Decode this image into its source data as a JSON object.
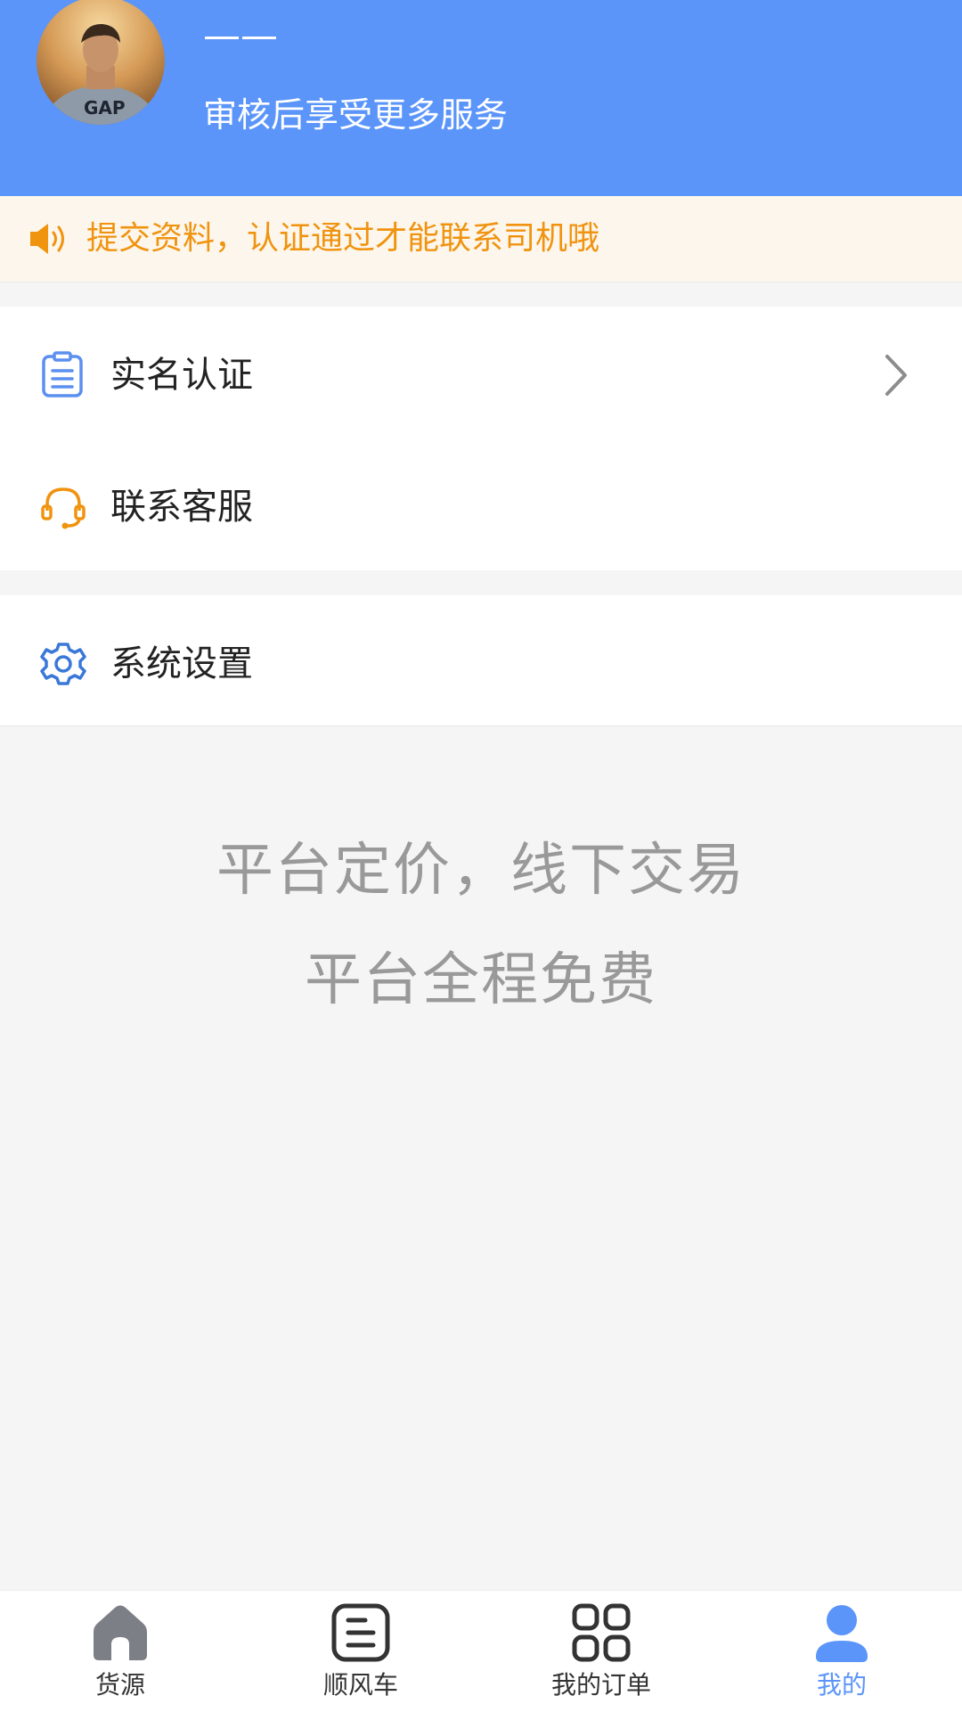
{
  "header": {
    "user_name": "——",
    "subtitle": "审核后享受更多服务",
    "avatar": "avatar-photo",
    "background_color": "#5b95fa"
  },
  "notice": {
    "icon": "speaker-icon",
    "text": "提交资料，认证通过才能联系司机哦",
    "color": "#f0930f"
  },
  "menu": {
    "group1": [
      {
        "label": "实名认证",
        "icon": "clipboard-icon",
        "chevron": true
      },
      {
        "label": "联系客服",
        "icon": "headset-icon",
        "chevron": false
      }
    ],
    "group2": [
      {
        "label": "系统设置",
        "icon": "gear-icon",
        "chevron": false
      }
    ]
  },
  "slogan": {
    "line1": "平台定价，线下交易",
    "line2": "平台全程免费"
  },
  "tabbar": {
    "active_color": "#5b95fa",
    "items": [
      {
        "label": "货源",
        "icon": "home-icon",
        "active": false
      },
      {
        "label": "顺风车",
        "icon": "list-icon",
        "active": false
      },
      {
        "label": "我的订单",
        "icon": "grid-icon",
        "active": false
      },
      {
        "label": "我的",
        "icon": "user-icon",
        "active": true
      }
    ]
  }
}
